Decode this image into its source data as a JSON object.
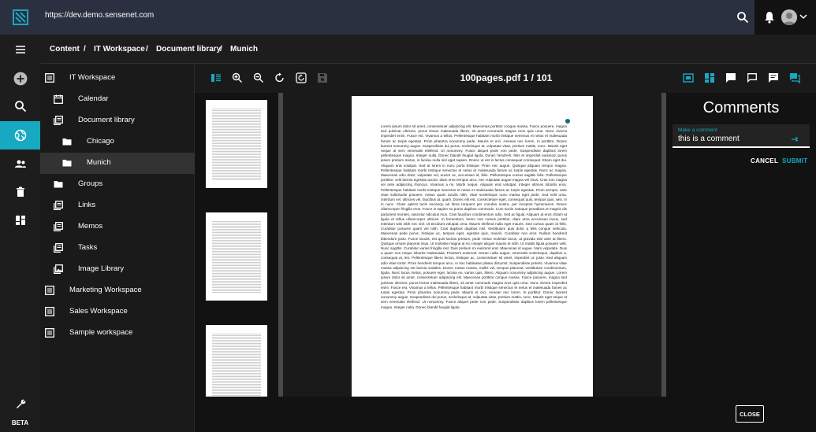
{
  "topbar": {
    "url": "https://dev.demo.sensenet.com",
    "logo": "sensenet-logo",
    "icons": [
      "search-icon",
      "bell-icon",
      "avatar",
      "chevron-down-icon"
    ]
  },
  "rail": {
    "items": [
      "menu-icon",
      "add-icon",
      "search-icon",
      "globe-icon",
      "users-icon",
      "trash-icon",
      "dashboard-icon"
    ],
    "active": "globe-icon",
    "bottom_icon": "wrench-icon",
    "beta_label": "BETA"
  },
  "breadcrumb": {
    "items": [
      "Content",
      "IT Workspace",
      "Document library",
      "Munich"
    ],
    "separator": "/"
  },
  "tree": {
    "items": [
      {
        "label": "IT Workspace",
        "icon": "workspace-icon"
      },
      {
        "label": "Calendar",
        "icon": "calendar-icon"
      },
      {
        "label": "Document library",
        "icon": "library-icon"
      },
      {
        "label": "Chicago",
        "icon": "folder-icon"
      },
      {
        "label": "Munich",
        "icon": "folder-icon"
      },
      {
        "label": "Groups",
        "icon": "folder-icon"
      },
      {
        "label": "Links",
        "icon": "list-icon"
      },
      {
        "label": "Memos",
        "icon": "list-icon"
      },
      {
        "label": "Tasks",
        "icon": "list-icon"
      },
      {
        "label": "Image Library",
        "icon": "image-icon"
      },
      {
        "label": "Marketing Workspace",
        "icon": "workspace-icon"
      },
      {
        "label": "Sales Workspace",
        "icon": "workspace-icon"
      },
      {
        "label": "Sample workspace",
        "icon": "workspace-icon"
      }
    ],
    "selected": "Munich"
  },
  "viewer": {
    "title": "100pages.pdf 1 / 101",
    "left_tools": [
      "thumbnails-icon",
      "zoom-in-icon",
      "zoom-out-icon",
      "rotate-icon",
      "rotate-page-icon",
      "save-icon"
    ],
    "right_tools": [
      "fit-page-icon",
      "view-mode-icon",
      "comment-icon",
      "comment-outline-icon",
      "comment-text-icon",
      "comment-active-icon"
    ],
    "page_text": "Lorem ipsum dolor sit amet, consectetuer adipiscing elit. Maecenas porttitor congue massa. Fusce posuere, magna sed pulvinar ultricies, purus lectus malesuada libero, sit amet commodo magna eros quis urna. Nunc viverra imperdiet enim. Fusce est. Vivamus a tellus. Pellentesque habitant morbi tristique senectus et netus et malesuada fames ac turpis egestas. Proin pharetra nonummy pede. Mauris et orci. Aenean nec lorem. In porttitor. Donec laoreet nonummy augue. Suspendisse dui purus, scelerisque at, vulputate vitae, pretium mattis, nunc. Mauris eget neque at sem venenatis eleifend. Ut nonummy. Fusce aliquet pede non pede. Suspendisse dapibus lorem pellentesque magna. Integer nulla. Donec blandit feugiat ligula. Donec hendrerit, felis et imperdiet euismod, purus ipsum pretium metus, in lacinia nulla nisl eget sapien. Donec ut est in lectus consequat consequat. Etiam eget dui. Aliquam erat volutpat. Sed at lorem in nunc porta tristique. Proin nec augue. Quisque aliquam tempor magna. Pellentesque habitant morbi tristique senectus et netus et malesuada fames ac turpis egestas. Nunc ac magna. Maecenas odio dolor, vulputate vel, auctor ac, accumsan id, felis. Pellentesque cursus sagittis felis. Pellentesque porttitor, velit lacinia egestas auctor, diam eros tempus arcu, nec vulputate augue magna vel risus. Cras non magna vel ante adipiscing rhoncus. Vivamus a mi. Morbi neque. Aliquam erat volutpat. Integer ultrices lobortis eros. Pellentesque habitant morbi tristique senectus et netus et malesuada fames ac turpis egestas. Proin semper, ante vitae sollicitudin posuere, metus quam iaculis nibh, vitae scelerisque nunc massa eget pede. Sed velit urna, interdum vel, ultricies vel, faucibus at, quam. Donec elit est, consectetuer eget, consequat quis, tempus quis, wisi. In in nunc. Class aptent taciti sociosqu ad litora torquent per conubia nostra, per inceptos hymenaeos. Donec ullamcorper fringilla eros. Fusce in sapien eu purus dapibus commodo. Cum sociis natoque penatibus et magnis dis parturient montes, nascetur ridiculus mus. Cras faucibus condimentum odio. Sed ac ligula. Aliquam at eros. Etiam at ligula et tellus ullamcorper ultrices. In fermentum, lorem non cursus porttitor, diam urna accumsan lacus, sed interdum wisi nibh nec nisl. Ut tincidunt volutpat urna. Mauris eleifend nulla eget mauris. Sed cursus quam id felis. Curabitur posuere quam vel nibh. Cras dapibus dapibus nisl. Vestibulum quis dolor a felis congue vehicula. Maecenas pede purus, tristique ac, tempus eget, egestas quis, mauris. Curabitur non eros. Nullam hendrerit bibendum justo. Fusce iaculis, est quis lacinia pretium, pede metus molestie lacus, at gravida wisi ante at libero. Quisque ornare placerat risus. Ut molestie magna at mi. Integer aliquet mauris et nibh. Ut mattis ligula posuere velit. Nunc sagittis. Curabitur varius fringilla nisl. Duis pretium mi euismod erat. Maecenas id augue. Nam vulputate. Duis a quam non neque lobortis malesuada. Praesent euismod. Donec nulla augue, venenatis scelerisque, dapibus a, consequat at, leo. Pellentesque libero lectus, tristique ac, consectetuer sit amet, imperdiet ut, justo. Sed aliquam odio vitae tortor. Proin hendrerit tempus arcu. In hac habitasse platea dictumst. Suspendisse potenti. Vivamus vitae massa adipiscing est lacinia sodales. Donec metus massa, mollis vel, tempus placerat, vestibulum condimentum, ligula. Nunc lacus metus, posuere eget, lacinia eu, varius quis, libero. Aliquam nonummy adipiscing augue. Lorem ipsum dolor sit amet, consectetuer adipiscing elit. Maecenas porttitor congue massa. Fusce posuere, magna sed pulvinar ultricies, purus lectus malesuada libero, sit amet commodo magna eros quis urna. Nunc viverra imperdiet enim. Fusce est. Vivamus a tellus. Pellentesque habitant morbi tristique senectus et netus et malesuada fames ac turpis egestas. Proin pharetra nonummy pede. Mauris et orci. Aenean nec lorem. In porttitor. Donec laoreet nonummy augue. Suspendisse dui purus, scelerisque at, vulputate vitae, pretium mattis, nunc. Mauris eget neque at sem venenatis eleifend. Ut nonummy. Fusce aliquet pede non pede. Suspendisse dapibus lorem pellentesque magna. Integer nulla. Donec blandit feugiat ligula."
  },
  "comments": {
    "title": "Comments",
    "input_label": "Make a comment",
    "input_value": "this is a comment",
    "cancel_label": "CANCEL",
    "submit_label": "SUBMIT",
    "close_label": "CLOSE"
  },
  "colors": {
    "accent": "#16a9c1",
    "topbar": "#2b3040",
    "background": "#121212"
  }
}
